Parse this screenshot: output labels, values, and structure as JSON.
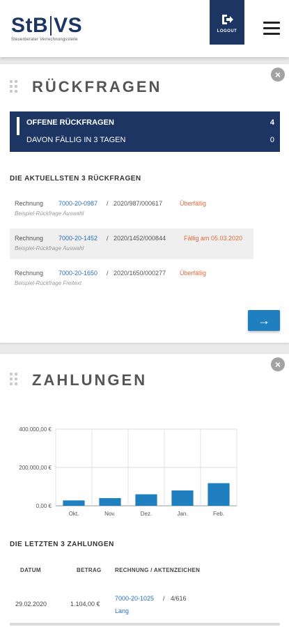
{
  "header": {
    "logo_part1": "StB",
    "logo_part2": "VS",
    "logo_subtitle": "Steuerberater Verrechnungsstelle",
    "logout_label": "LOGOUT",
    "brand_color": "#1c3563"
  },
  "rueckfragen": {
    "title": "RÜCKFRAGEN",
    "summary": {
      "open_label": "OFFENE RÜCKFRAGEN",
      "open_count": "4",
      "due_label": "DAVON FÄLLIG IN 3 TAGEN",
      "due_count": "0"
    },
    "latest_heading": "DIE AKTUELLSTEN 3 RÜCKFRAGEN",
    "items": [
      {
        "type": "Rechnung",
        "invoice": "7000-20-0987",
        "sep": "/",
        "ref": "2020/987/000617",
        "status": "Überfällig",
        "description": "Beispiel-Rückfrage Auswahl"
      },
      {
        "type": "Rechnung",
        "invoice": "7000-20-1452",
        "sep": "/",
        "ref": "2020/1452/000844",
        "status": "Fällig am 05.03.2020",
        "description": "Beispiel-Rückfrage Auswahl"
      },
      {
        "type": "Rechnung",
        "invoice": "7000-20-1650",
        "sep": "/",
        "ref": "2020/1650/000277",
        "status": "Überfällig",
        "description": "Beispiel-Rückfrage Freitext"
      }
    ],
    "next_arrow": "→"
  },
  "zahlungen": {
    "title": "ZAHLUNGEN",
    "latest_heading": "DIE LETZTEN 3 ZAHLUNGEN",
    "columns": [
      "DATUM",
      "BETRAG",
      "RECHNUNG / AKTENZEICHEN"
    ],
    "rows": [
      {
        "date": "29.02.2020",
        "amount": "1.104,00 €",
        "invoice": "7000-20-1025",
        "sep": "/",
        "ref": "4/616",
        "ref2": "Lang"
      }
    ]
  },
  "chart_data": {
    "type": "bar",
    "categories": [
      "Okt.",
      "Nov.",
      "Dez.",
      "Jan.",
      "Feb."
    ],
    "values": [
      28000,
      40000,
      60000,
      80000,
      118000
    ],
    "ytick_labels": [
      "0,00 €",
      "200.000,00 €",
      "400.000,00 €"
    ],
    "yticks": [
      0,
      200000,
      400000
    ],
    "ylim": [
      0,
      400000
    ],
    "bar_color": "#1f7fbf",
    "grid": true
  },
  "colors": {
    "accent_link": "#2a6fb3",
    "status_orange": "#e16a3a",
    "button_blue": "#1f7fbf"
  }
}
